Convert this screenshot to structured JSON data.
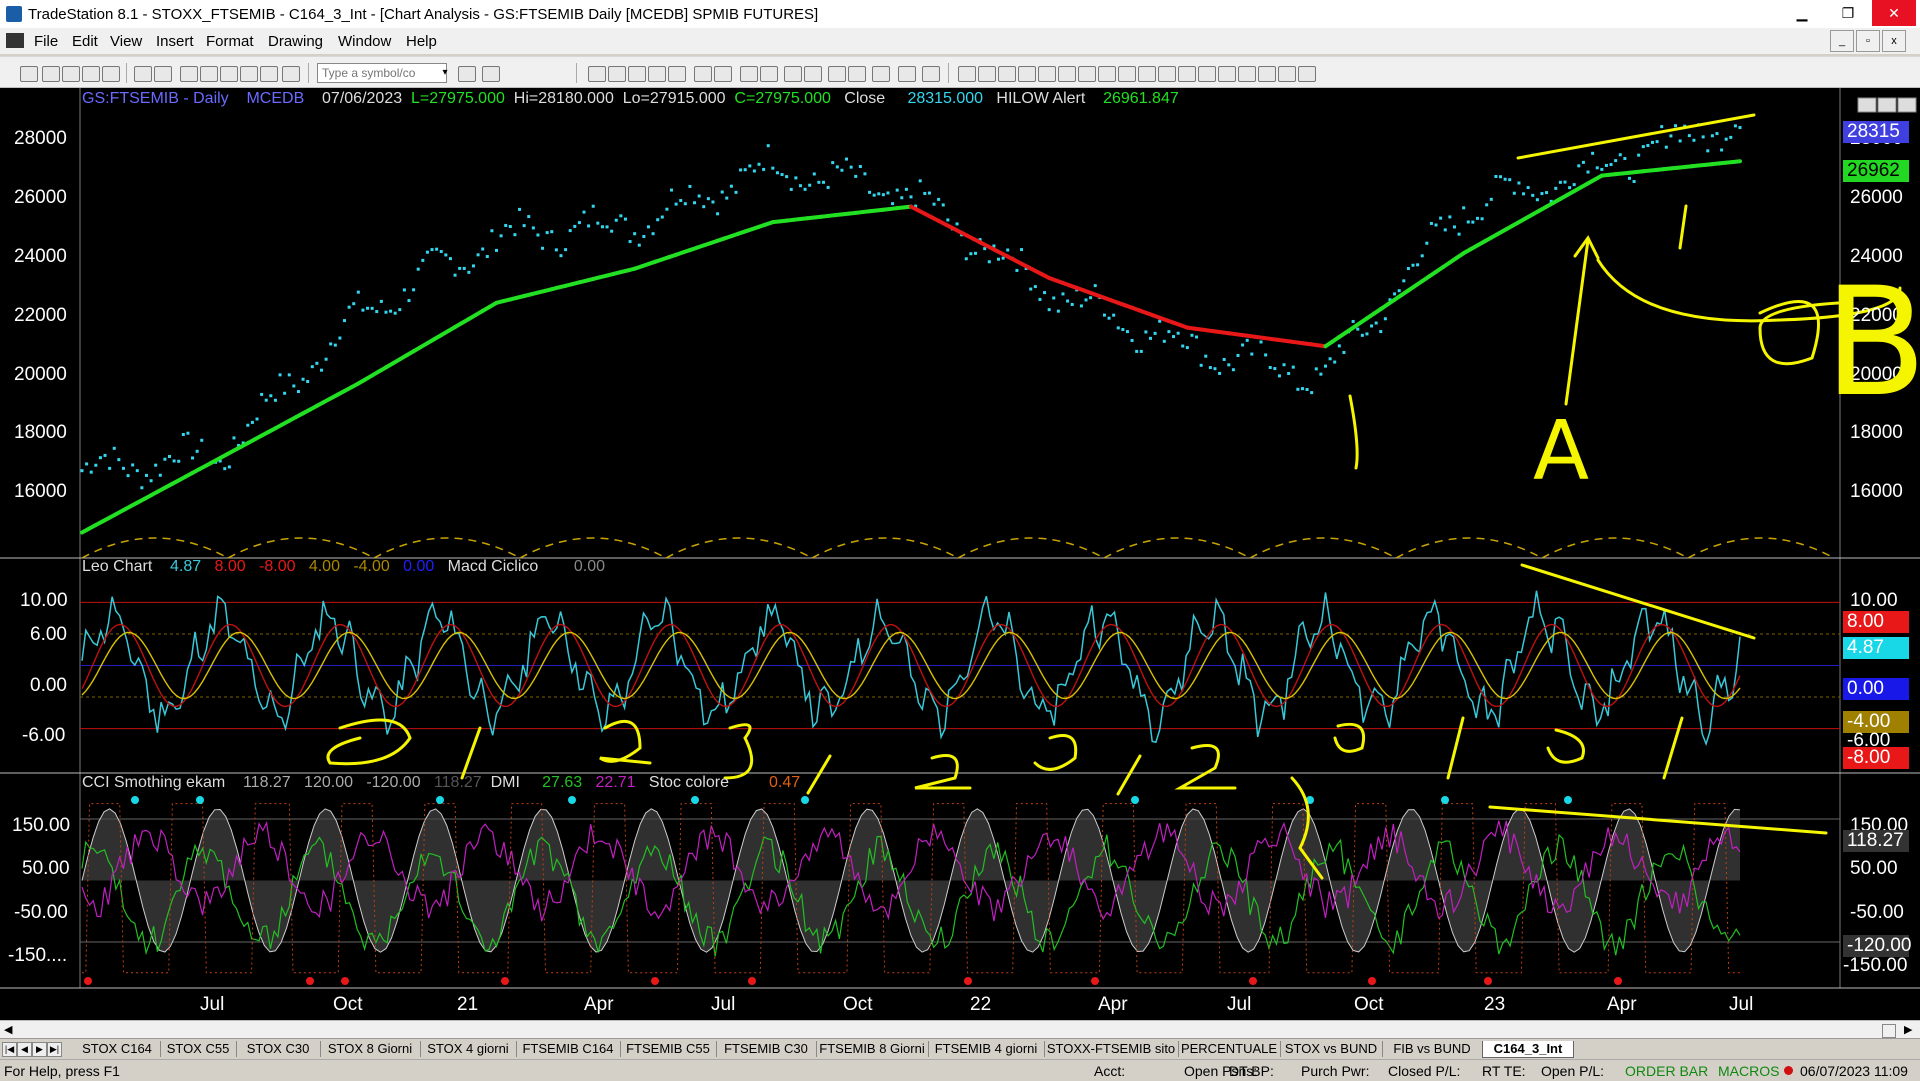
{
  "window": {
    "title": "TradeStation 8.1 - STOXX_FTSEMIB - C164_3_Int - [Chart Analysis - GS:FTSEMIB  Daily  [MCEDB] SPMIB FUTURES]",
    "min": "▁",
    "restore": "❐",
    "close": "✕"
  },
  "menu": [
    "File",
    "Edit",
    "View",
    "Insert",
    "Format",
    "Drawing",
    "Window",
    "Help"
  ],
  "mdi": {
    "min": "_",
    "restore": "▫",
    "close": "x"
  },
  "toolbar": {
    "symbol_placeholder": "Type a symbol/co",
    "drop": "▾"
  },
  "chart": {
    "symbol": "GS:FTSEMIB - Daily",
    "feed": "MCEDB",
    "date": "07/06/2023",
    "L": "L=27975.000",
    "H": "Hi=28180.000",
    "Lo": "Lo=27915.000",
    "C": "C=27975.000",
    "close_label": "Close",
    "close_value": "28315.000",
    "hilow_label": "HILOW Alert",
    "hilow_value": "26961.847",
    "price_ticks": [
      "28000",
      "26000",
      "24000",
      "22000",
      "20000",
      "18000",
      "16000"
    ],
    "price_tag_close": "28315",
    "price_tag_hilow": "26962",
    "osc_header": {
      "name": "Leo Chart",
      "v1": "4.87",
      "v2": "8.00",
      "v3": "-8.00",
      "v4": "4.00",
      "v5": "-4.00",
      "v6": "0.00",
      "name2": "Macd Ciclico",
      "v7": "0.00"
    },
    "osc_ticks": [
      "10.00",
      "6.00",
      "0.00",
      "-6.00"
    ],
    "osc_tags": {
      "t1": "8.00",
      "t2": "4.87",
      "t3": "0.00",
      "t4": "-4.00",
      "t5": "-6.00",
      "t6": "-8.00"
    },
    "cci_header": {
      "name": "CCI Smothing ekam",
      "v1": "118.27",
      "v2": "120.00",
      "v3": "-120.00",
      "v4": "118.27",
      "dmi_label": "DMI",
      "v5": "27.63",
      "v6": "22.71",
      "stoc_label": "Stoc colore",
      "v7": "0.47"
    },
    "cci_ticks": [
      "150.00",
      "50.00",
      "-50.00",
      "-150...."
    ],
    "cci_tags": {
      "t1": "150.00",
      "t2": "118.27",
      "t3": "50.00",
      "t4": "-50.00",
      "t5": "-120.00",
      "t6": "-150.00"
    },
    "x_labels": [
      "Jul",
      "Oct",
      "21",
      "Apr",
      "Jul",
      "Oct",
      "22",
      "Apr",
      "Jul",
      "Oct",
      "23",
      "Apr",
      "Jul"
    ]
  },
  "chart_data": {
    "type": "line",
    "title": "GS:FTSEMIB - Daily",
    "x": [
      "Jul",
      "Oct",
      "21",
      "Apr",
      "Jul",
      "Oct",
      "22",
      "Apr",
      "Jul",
      "Oct",
      "23",
      "Apr",
      "Jul"
    ],
    "ylim": [
      14500,
      29000
    ],
    "series": [
      {
        "name": "Close",
        "values": [
          17000,
          17500,
          22000,
          24500,
          25000,
          26800,
          25800,
          22800,
          21000,
          20000,
          25500,
          26800,
          28315
        ]
      },
      {
        "name": "HILOW Alert",
        "values": [
          15000,
          17400,
          19800,
          22400,
          23500,
          25000,
          25500,
          23200,
          21600,
          21000,
          24000,
          26500,
          26962
        ]
      }
    ]
  },
  "annotations": {
    "letter_a": "A",
    "letter_b": "B"
  },
  "tabs": [
    "STOX C164",
    "STOX C55",
    "STOX  C30",
    "STOX  8 Giorni",
    "STOX 4 giorni",
    "FTSEMIB C164",
    "FTSEMIB C55",
    "FTSEMIB C30",
    "FTSEMIB  8 Giorni",
    "FTSEMIB  4 giorni",
    "STOXX-FTSEMIB sito",
    "PERCENTUALE",
    "STOX vs BUND",
    "FIB vs BUND",
    "C164_3_Int"
  ],
  "status": {
    "help": "For Help, press F1",
    "acct": "Acct:",
    "open_psns": "Open Psns:",
    "dt_bp": "DT BP:",
    "purch_pwr": "Purch Pwr:",
    "closed_pl": "Closed P/L:",
    "rt_te": "RT TE:",
    "open_pl": "Open P/L:",
    "order_bar": "ORDER BAR",
    "macros": "MACROS",
    "datetime": "06/07/2023 11:09"
  },
  "colors": {
    "price_dots": "#33d8f0",
    "hilow_up": "#22e022",
    "hilow_down": "#e81818",
    "annotation": "#f5f500",
    "osc_cyan": "#38c8d8",
    "dmi_plus": "#22c022",
    "dmi_minus": "#c020c0"
  }
}
